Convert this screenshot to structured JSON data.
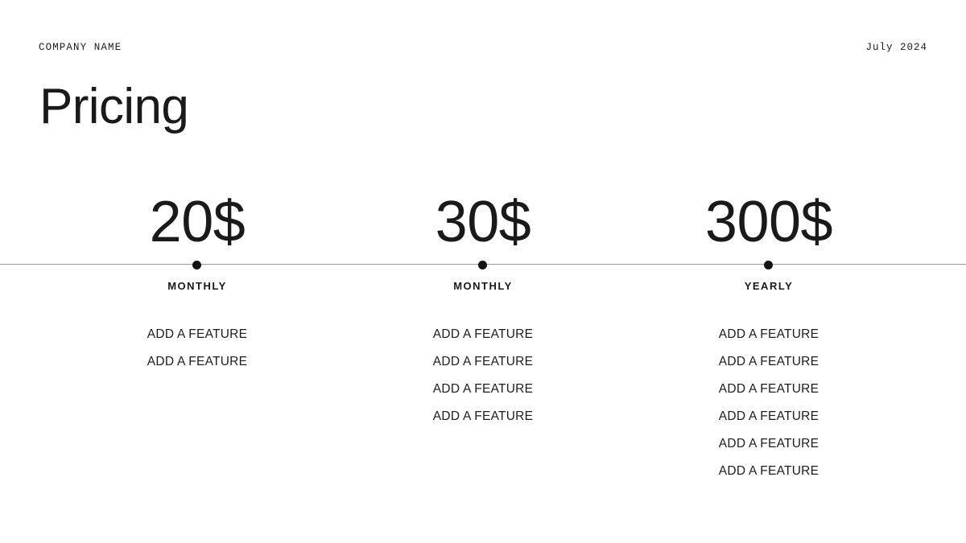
{
  "slide": {
    "background_color": "#ffffff",
    "text_color": "#1a1a1a",
    "rule_color": "#9a9a9a",
    "dot_color": "#141414"
  },
  "header": {
    "company_name": "COMPANY NAME",
    "date": "July 2024"
  },
  "title": "Pricing",
  "plans": [
    {
      "price": "20$",
      "period": "MONTHLY",
      "features": [
        "ADD A FEATURE",
        "ADD A FEATURE"
      ]
    },
    {
      "price": "30$",
      "period": "MONTHLY",
      "features": [
        "ADD A FEATURE",
        "ADD A FEATURE",
        "ADD A FEATURE",
        "ADD A FEATURE"
      ]
    },
    {
      "price": "300$",
      "period": "YEARLY",
      "features": [
        "ADD A FEATURE",
        "ADD A FEATURE",
        "ADD A FEATURE",
        "ADD A FEATURE",
        "ADD A FEATURE",
        "ADD A FEATURE"
      ]
    }
  ]
}
